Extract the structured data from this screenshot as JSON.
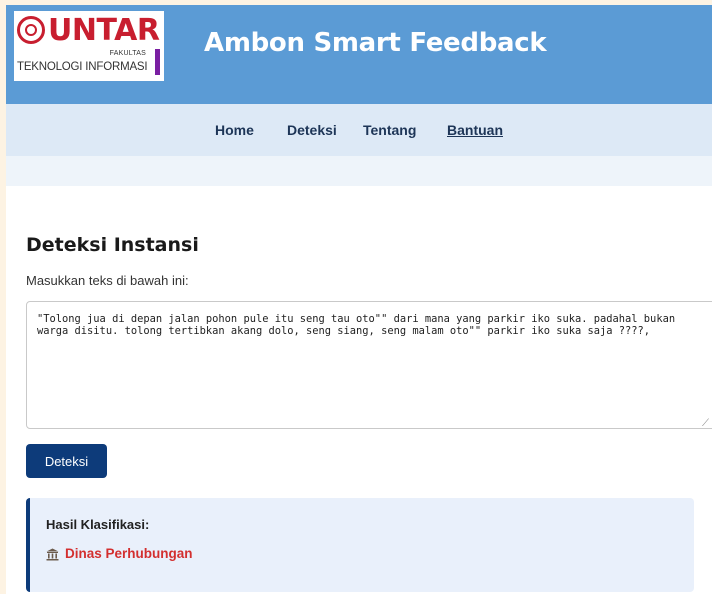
{
  "header": {
    "logo": {
      "brand": "UNTAR",
      "fakultas": "FAKULTAS",
      "department": "TEKNOLOGI INFORMASI"
    },
    "title": "Ambon Smart Feedback"
  },
  "nav": {
    "items": [
      {
        "label": "Home"
      },
      {
        "label": "Deteksi"
      },
      {
        "label": "Tentang"
      },
      {
        "label": "Bantuan"
      }
    ]
  },
  "main": {
    "title": "Deteksi Instansi",
    "instruction": "Masukkan teks di bawah ini:",
    "input_value": "\"Tolong jua di depan jalan pohon pule itu seng tau oto\"\" dari mana yang parkir iko suka. padahal bukan\nwarga disitu. tolong tertibkan akang dolo, seng siang, seng malam oto\"\" parkir iko suka saja ????,",
    "detect_label": "Deteksi"
  },
  "result": {
    "label": "Hasil Klasifikasi:",
    "icon": "government-building-icon",
    "value": "Dinas Perhubungan"
  },
  "colors": {
    "header_bg": "#5b9bd5",
    "nav_bg": "#dde9f6",
    "button_bg": "#0d3b7a",
    "result_bg": "#e9f0fb",
    "result_text": "#d32f2f",
    "brand_red": "#c81e2f"
  }
}
